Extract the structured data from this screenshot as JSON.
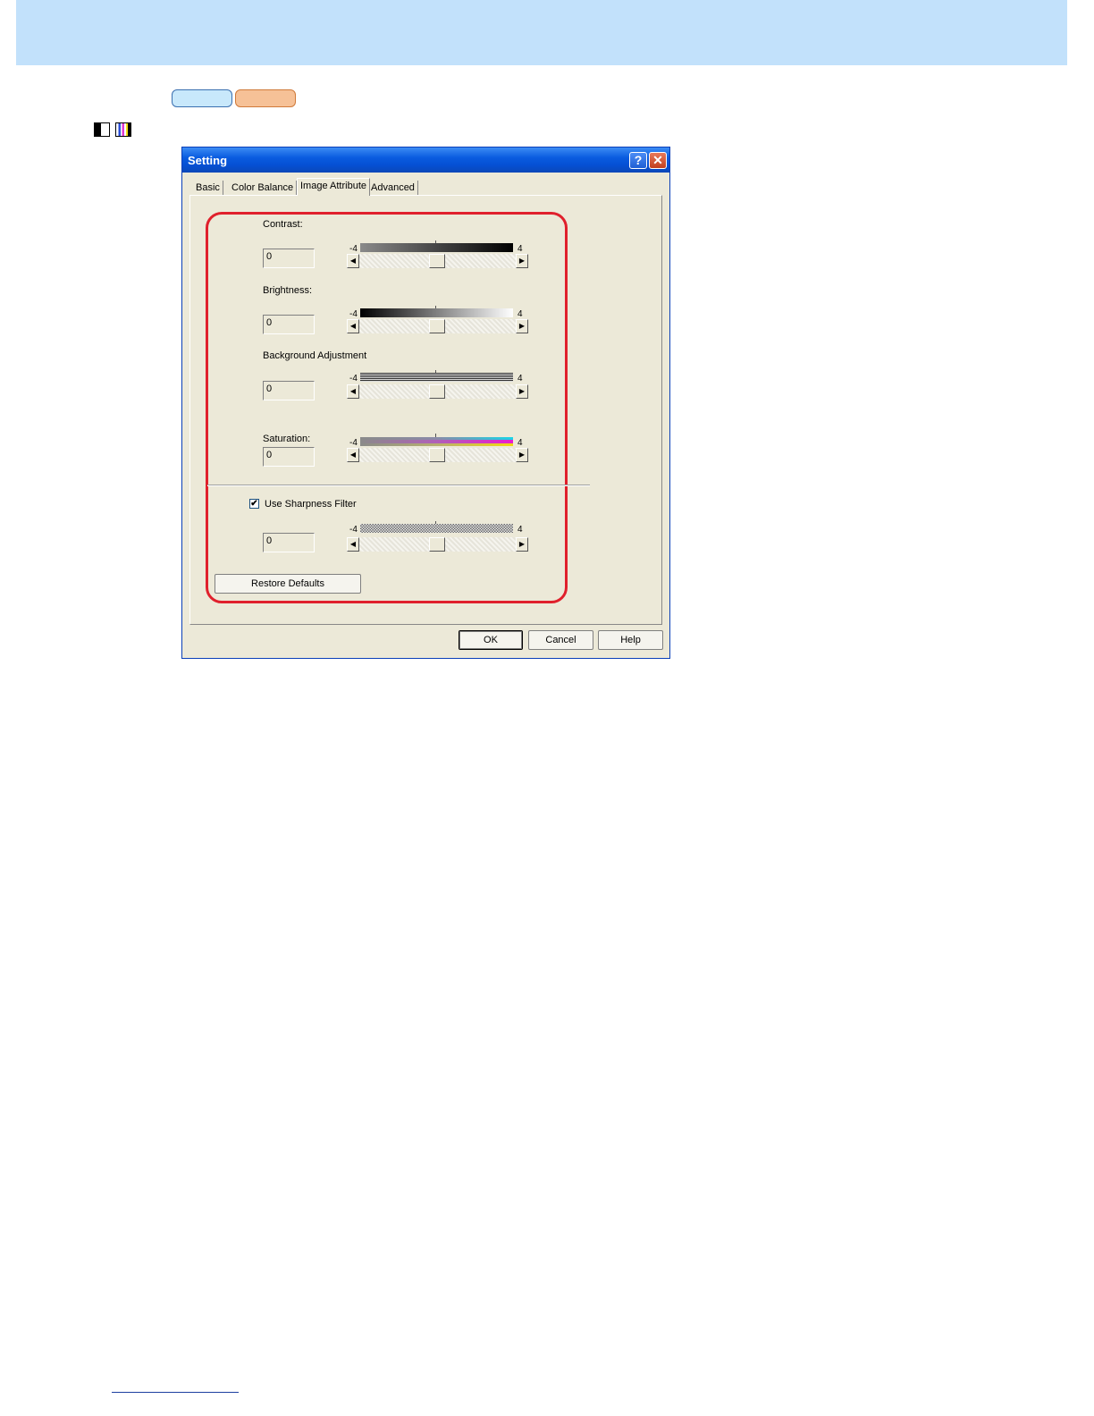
{
  "colors": {
    "header_band": "#c2e1fb",
    "pill_blue": "#c8e8fb",
    "pill_orange": "#f6c197",
    "highlight": "#e0202c",
    "titlebar": "#0550d4"
  },
  "icons": {
    "mono": "monochrome-mode-icon",
    "color": "color-mode-icon",
    "help": "question-mark-icon",
    "close": "close-x-icon",
    "check": "checkmark-icon",
    "arrow_left": "left-arrow-icon",
    "arrow_right": "right-arrow-icon"
  },
  "dialog": {
    "title": "Setting",
    "help_glyph": "?",
    "close_glyph": "✕",
    "tabs": [
      {
        "label": "Basic"
      },
      {
        "label": "Color Balance"
      },
      {
        "label": "Image Attribute",
        "active": true
      },
      {
        "label": "Advanced"
      }
    ],
    "sliders": [
      {
        "label": "Contrast:",
        "value": "0",
        "min_label": "-4",
        "max_label": "4",
        "position": 0
      },
      {
        "label": "Brightness:",
        "value": "0",
        "min_label": "-4",
        "max_label": "4",
        "position": 0
      },
      {
        "label": "Background Adjustment",
        "value": "0",
        "min_label": "-4",
        "max_label": "4",
        "position": 0
      },
      {
        "label": "Saturation:",
        "value": "0",
        "min_label": "-4",
        "max_label": "4",
        "position": 0
      }
    ],
    "sharpness": {
      "checkbox_label": "Use Sharpness Filter",
      "checked": true,
      "check_glyph": "✔",
      "value": "0",
      "min_label": "-4",
      "max_label": "4",
      "position": 0
    },
    "arrow_left_glyph": "◀",
    "arrow_right_glyph": "▶",
    "restore_label": "Restore Defaults",
    "ok_label": "OK",
    "cancel_label": "Cancel",
    "help_label": "Help"
  }
}
